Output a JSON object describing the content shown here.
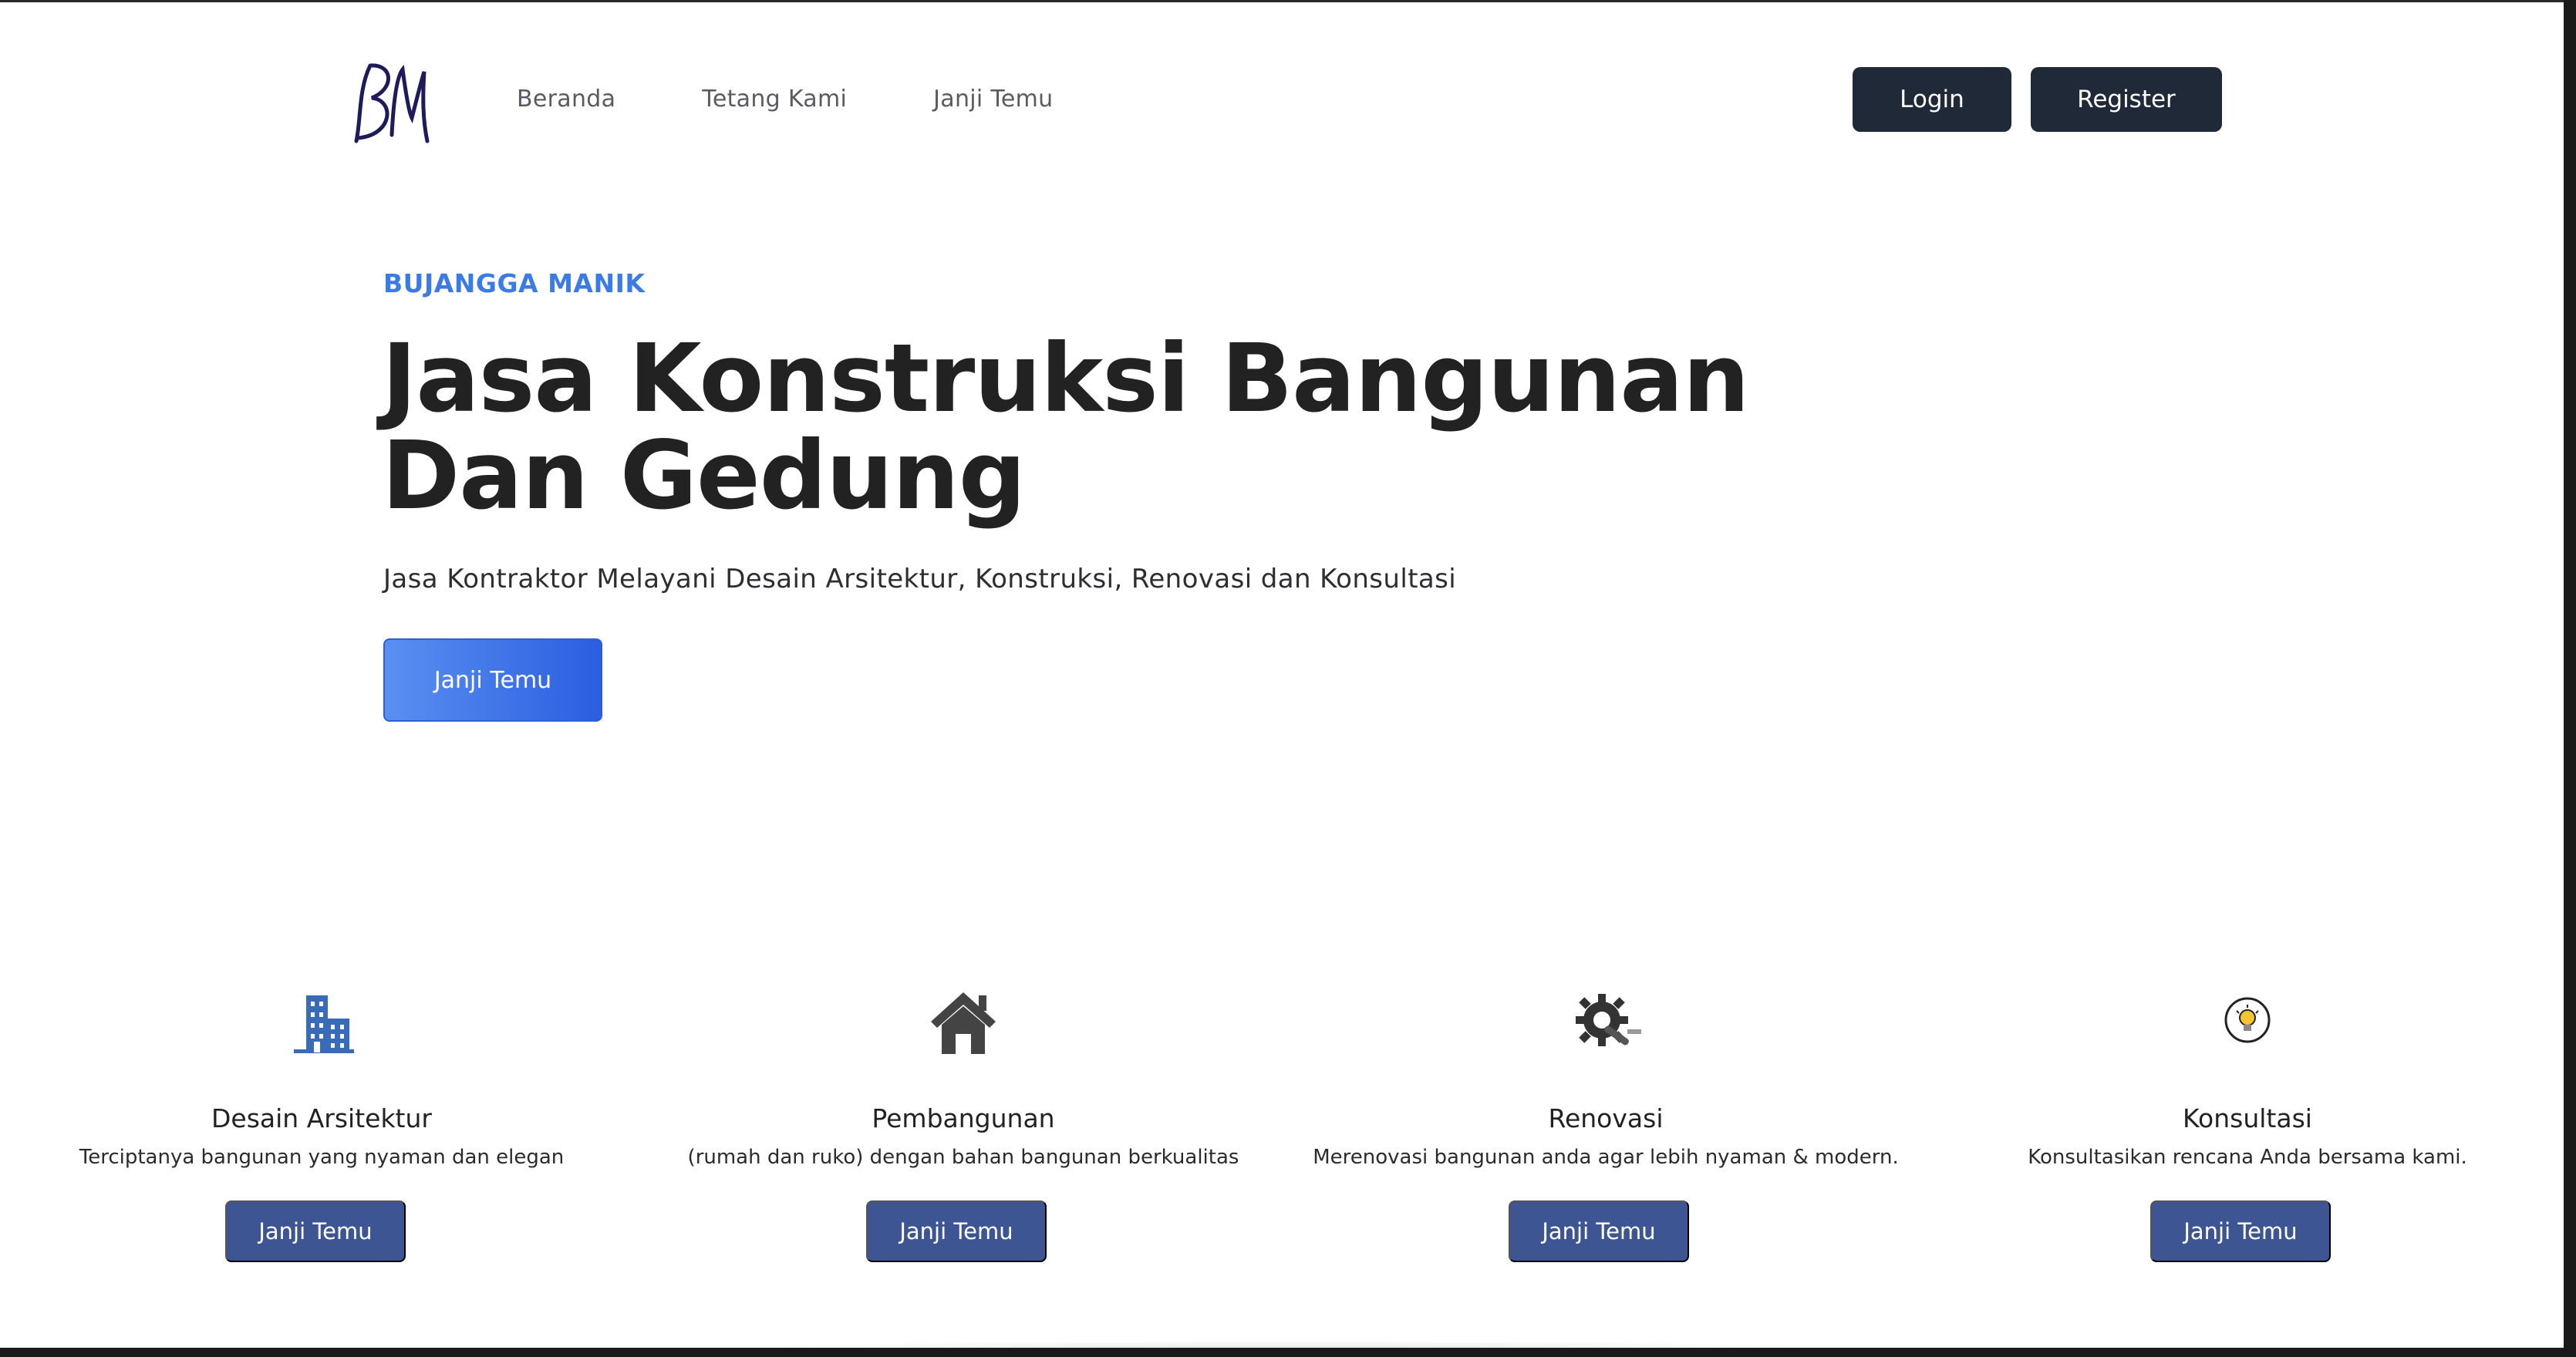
{
  "nav": {
    "links": [
      "Beranda",
      "Tetang Kami",
      "Janji Temu"
    ],
    "login": "Login",
    "register": "Register"
  },
  "hero": {
    "kicker": "BUJANGGA MANIK",
    "headline": "Jasa Konstruksi Bangunan Dan Gedung",
    "subhead": "Jasa Kontraktor Melayani Desain Arsitektur, Konstruksi, Renovasi dan Konsultasi",
    "cta": "Janji Temu"
  },
  "services": [
    {
      "icon": "building-icon",
      "title": "Desain Arsitektur",
      "desc": "Terciptanya bangunan yang nyaman dan elegan",
      "cta": "Janji Temu"
    },
    {
      "icon": "house-icon",
      "title": "Pembangunan",
      "desc": "(rumah dan ruko) dengan bahan bangunan berkualitas",
      "cta": "Janji Temu"
    },
    {
      "icon": "gear-wrench-icon",
      "title": "Renovasi",
      "desc": "Merenovasi bangunan anda agar lebih nyaman & modern.",
      "cta": "Janji Temu"
    },
    {
      "icon": "lightbulb-tips-icon",
      "title": "Konsultasi",
      "desc": "Konsultasikan rencana Anda bersama kami.",
      "cta": "Janji Temu"
    }
  ],
  "colors": {
    "accent": "#3b7be5",
    "dark_button": "#1f2937",
    "service_button": "#3d5592"
  }
}
